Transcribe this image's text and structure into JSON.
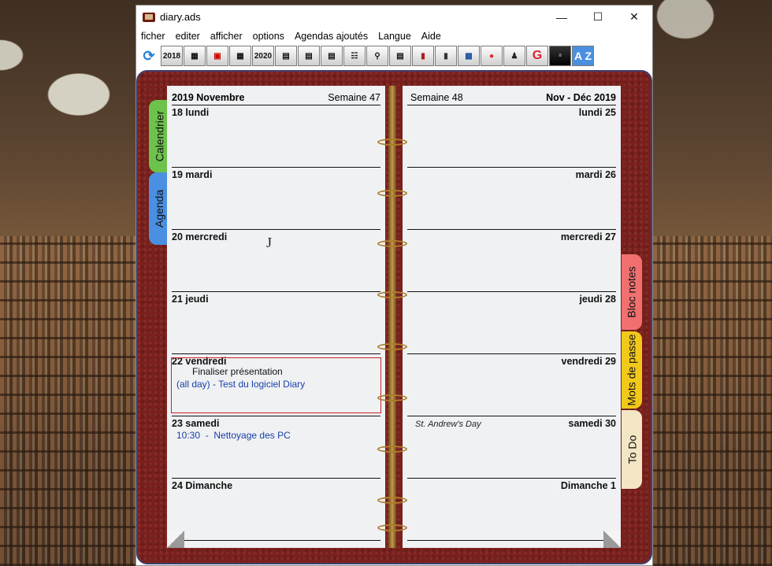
{
  "window": {
    "title": "diary.ads"
  },
  "menu": [
    "ficher",
    "editer",
    "afficher",
    "options",
    "Agendas ajoutés",
    "Langue",
    "Aide"
  ],
  "toolbar": {
    "year_prev": "2018",
    "year_next": "2020",
    "az": "A Z"
  },
  "left_page": {
    "header_left": "2019 Novembre",
    "header_right": "Semaine 47",
    "days": [
      {
        "label": "18 lundi",
        "notes": []
      },
      {
        "label": "19 mardi",
        "notes": []
      },
      {
        "label": "20 mercredi",
        "notes": []
      },
      {
        "label": "21 jeudi",
        "notes": []
      },
      {
        "label": "22 vendredi",
        "notes": [
          "Finaliser présentation",
          "(all day) - Test du logiciel Diary"
        ]
      },
      {
        "label": "23 samedi",
        "notes": [
          "10:30  -  Nettoyage des PC"
        ]
      },
      {
        "label": "24 Dimanche",
        "notes": []
      }
    ]
  },
  "right_page": {
    "header_left": "Semaine 48",
    "header_right": "Nov - Déc 2019",
    "days": [
      {
        "label": "lundi 25",
        "notes": []
      },
      {
        "label": "mardi 26",
        "notes": []
      },
      {
        "label": "mercredi 27",
        "notes": []
      },
      {
        "label": "jeudi 28",
        "notes": []
      },
      {
        "label": "vendredi 29",
        "notes": []
      },
      {
        "label": "samedi 30",
        "notes": [
          "St. Andrew's Day"
        ]
      },
      {
        "label": "Dimanche 1",
        "notes": []
      }
    ]
  },
  "tabs": {
    "left": [
      "Calendrier",
      "Agenda"
    ],
    "right": [
      "Bloc notes",
      "Mots de passe",
      "To Do"
    ]
  },
  "colors": {
    "binder": "#7a1f1b",
    "tab_calendrier": "#6cc24a",
    "tab_agenda": "#4a90e2",
    "tab_bloc": "#f07070",
    "tab_mots": "#f2c81a",
    "tab_todo": "#f3e6c4",
    "event_blue": "#1a3fa8",
    "selection_red": "#cc2222"
  }
}
